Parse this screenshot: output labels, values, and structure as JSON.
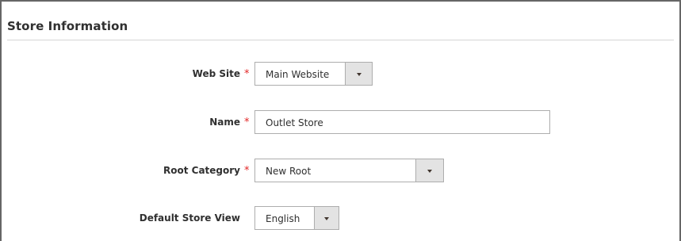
{
  "section": {
    "title": "Store Information"
  },
  "fields": {
    "website": {
      "label": "Web Site",
      "required": "*",
      "value": "Main Website",
      "icon": "chevron-down-icon"
    },
    "name": {
      "label": "Name",
      "required": "*",
      "value": "Outlet Store"
    },
    "root_category": {
      "label": "Root Category",
      "required": "*",
      "value": "New Root",
      "icon": "chevron-down-icon"
    },
    "default_store_view": {
      "label": "Default Store View",
      "value": "English",
      "icon": "chevron-down-icon"
    }
  },
  "colors": {
    "required": "#e22626",
    "border": "#adadad",
    "select_button": "#e3e3e3",
    "frame": "#666666"
  }
}
